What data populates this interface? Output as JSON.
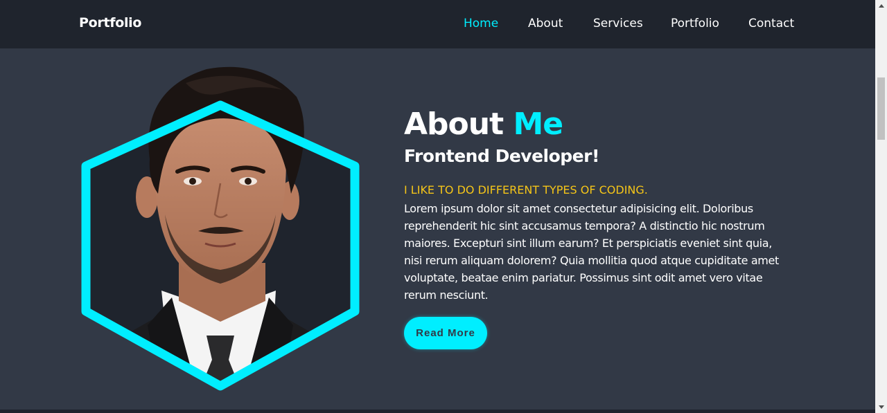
{
  "header": {
    "logo": "Portfolio",
    "nav": [
      {
        "label": "Home",
        "active": true
      },
      {
        "label": "About",
        "active": false
      },
      {
        "label": "Services",
        "active": false
      },
      {
        "label": "Portfolio",
        "active": false
      },
      {
        "label": "Contact",
        "active": false
      }
    ]
  },
  "about": {
    "title_main": "About",
    "title_accent": "Me",
    "subtitle": "Frontend Developer!",
    "tagline": "I LIKE TO DO DIFFERENT TYPES OF CODING.",
    "paragraph": "Lorem ipsum dolor sit amet consectetur adipisicing elit. Doloribus reprehenderit hic sint accusamus tempora? A distinctio hic nostrum maiores. Excepturi sint illum earum? Et perspiciatis eveniet sint quia, nisi rerum aliquam dolorem? Quia mollitia quod atque cupiditate amet voluptate, beatae enim pariatur. Possimus sint odit amet vero vitae rerum nesciunt.",
    "button_label": "Read More"
  },
  "icons": {
    "profile_photo": "profile-photo",
    "scroll_up": "scroll-up-arrow-icon",
    "scroll_down": "scroll-down-arrow-icon"
  },
  "colors": {
    "accent": "#00eeff",
    "background": "#323946",
    "header_bg": "#1f242d",
    "tagline": "#f5c518",
    "text": "#ffffff"
  }
}
